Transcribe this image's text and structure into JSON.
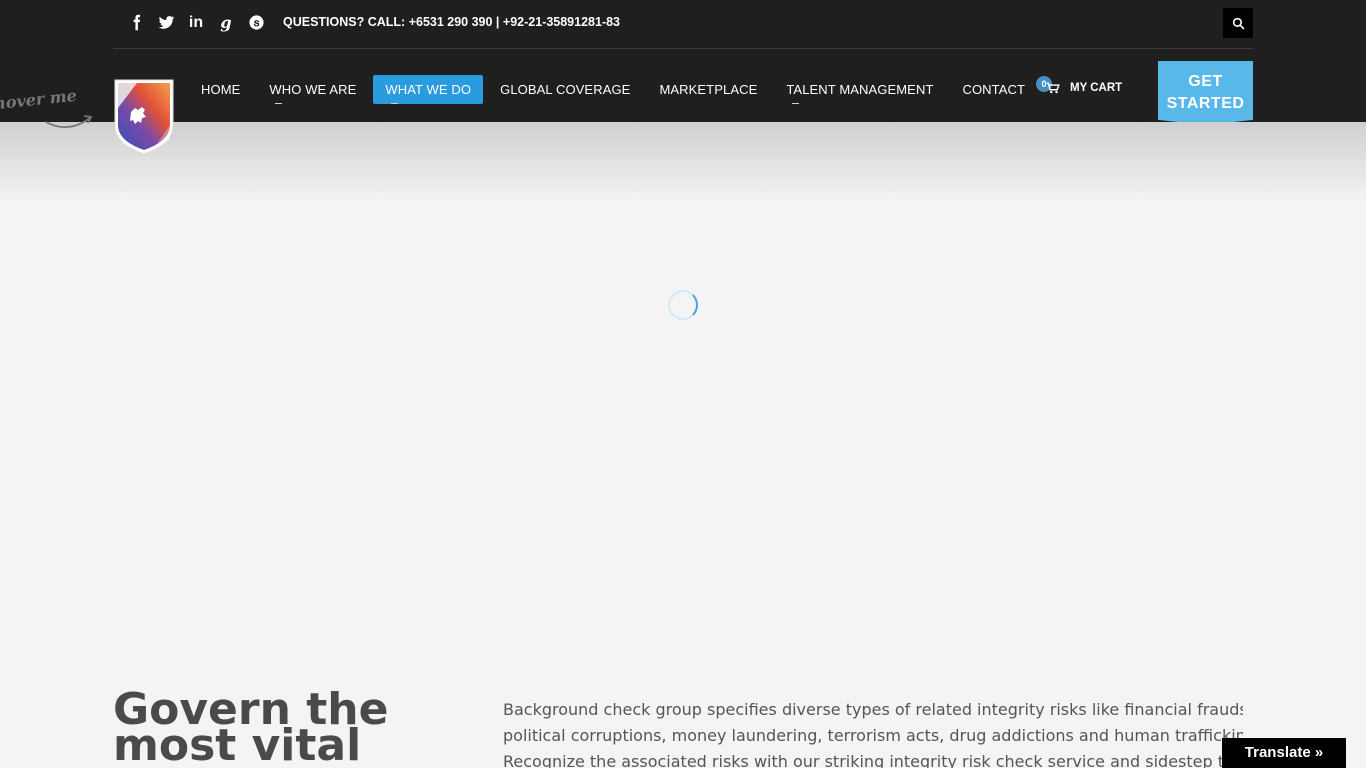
{
  "topbar": {
    "social": [
      "facebook-icon",
      "twitter-icon",
      "linkedin-icon",
      "google-plus-icon",
      "skype-icon"
    ],
    "social_glyphs": {
      "linkedin": "in",
      "google": "g"
    },
    "call_text": "QUESTIONS? CALL: +6531 290 390 | +92-21-35891281-83"
  },
  "hover_me": "hover me",
  "nav": {
    "items": [
      {
        "label": "HOME"
      },
      {
        "label": "WHO WE ARE"
      },
      {
        "label": "WHAT WE DO"
      },
      {
        "label": "GLOBAL COVERAGE"
      },
      {
        "label": "MARKETPLACE"
      },
      {
        "label": "TALENT MANAGEMENT"
      },
      {
        "label": "CONTACT"
      }
    ],
    "active": "WHAT WE DO"
  },
  "cart": {
    "count": "0",
    "label": "MY CART"
  },
  "cta": {
    "line1": "GET",
    "line2": "STARTED"
  },
  "content": {
    "heading_line1": "Govern the",
    "heading_line2": "most vital",
    "paragraph_line1": "Background check group specifies diverse types of related integrity risks like financial frauds,",
    "paragraph_line2": "political corruptions, money laundering, terrorism acts, drug addictions and human trafficking etc.",
    "paragraph_line3": "Recognize the associated risks with our striking integrity risk check service and sidestep the threats"
  },
  "translate_label": "Translate »",
  "colors": {
    "header_bg": "#1f1f1f",
    "accent": "#2b9be0",
    "cta": "#58b8ea",
    "page_bg": "#f4f4f4"
  }
}
